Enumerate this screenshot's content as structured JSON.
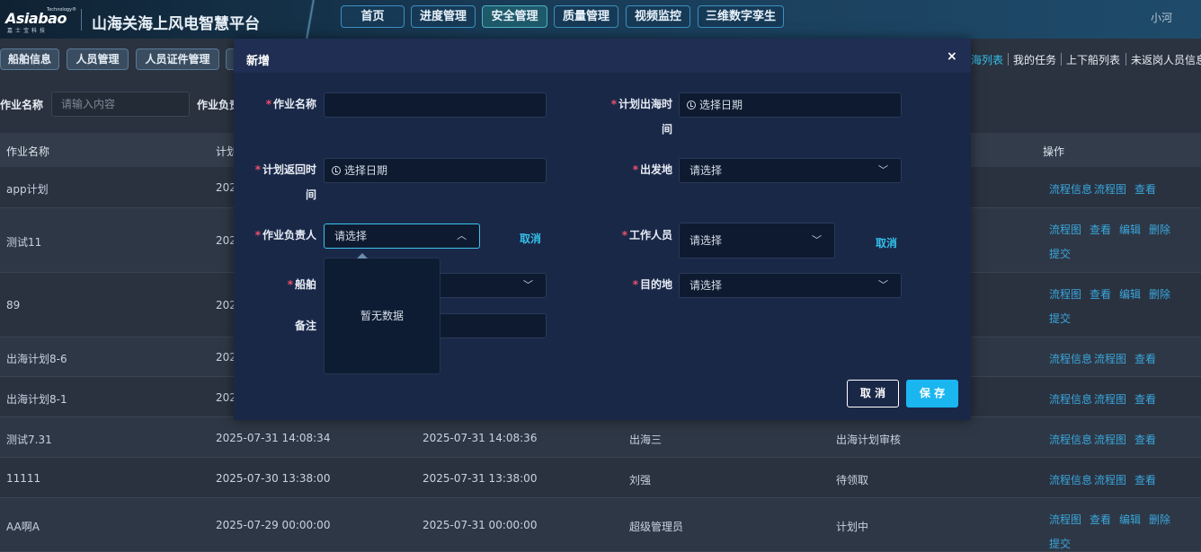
{
  "header": {
    "logo_text": "Asiabao",
    "logo_small": "Technology®",
    "logo_cn": "嘉士宝科技",
    "app_title": "山海关海上风电智慧平台",
    "nav": [
      "首页",
      "进度管理",
      "安全管理",
      "质量管理",
      "视频监控",
      "三维数字孪生"
    ],
    "active_nav": "安全管理",
    "user": "小河"
  },
  "subnav": {
    "buttons": [
      "船舶信息",
      "人员管理",
      "人员证件管理"
    ],
    "links": [
      "海列表",
      "我的任务",
      "上下船列表",
      "未返岗人员信息"
    ]
  },
  "filters": {
    "label1": "作业名称",
    "placeholder1": "请输入内容",
    "label2": "作业负责"
  },
  "table": {
    "headers": [
      "作业名称",
      "计划",
      "操作"
    ],
    "rows": [
      {
        "name": "app计划",
        "c2": "202",
        "c3": "",
        "c4": "",
        "c5": "",
        "ops": [
          "流程信息",
          "流程图",
          "查看"
        ]
      },
      {
        "name": "测试11",
        "c2": "202",
        "c3": "",
        "c4": "",
        "c5": "",
        "ops": [
          "流程图",
          "查看",
          "编辑",
          "删除",
          "提交"
        ]
      },
      {
        "name": "89",
        "c2": "202",
        "c3": "",
        "c4": "",
        "c5": "",
        "ops": [
          "流程图",
          "查看",
          "编辑",
          "删除",
          "提交"
        ]
      },
      {
        "name": "出海计划8-6",
        "c2": "202",
        "c3": "",
        "c4": "",
        "c5": "",
        "ops": [
          "流程信息",
          "流程图",
          "查看"
        ]
      },
      {
        "name": "出海计划8-1",
        "c2": "202",
        "c3": "",
        "c4": "",
        "c5": "",
        "ops": [
          "流程信息",
          "流程图",
          "查看"
        ]
      },
      {
        "name": "测试7.31",
        "c2": "2025-07-31 14:08:34",
        "c3": "2025-07-31 14:08:36",
        "c4": "出海三",
        "c5": "出海计划审核",
        "ops": [
          "流程信息",
          "流程图",
          "查看"
        ]
      },
      {
        "name": "11111",
        "c2": "2025-07-30 13:38:00",
        "c3": "2025-07-31 13:38:00",
        "c4": "刘强",
        "c5": "待领取",
        "ops": [
          "流程信息",
          "流程图",
          "查看"
        ]
      },
      {
        "name": "AA啊A",
        "c2": "2025-07-29 00:00:00",
        "c3": "2025-07-31 00:00:00",
        "c4": "超级管理员",
        "c5": "计划中",
        "ops": [
          "流程图",
          "查看",
          "编辑",
          "删除",
          "提交"
        ]
      }
    ]
  },
  "modal": {
    "title": "新增",
    "close": "×",
    "fields": {
      "job_name": {
        "label": "作业名称",
        "value": ""
      },
      "plan_out": {
        "label1": "计划出海时",
        "label2": "间",
        "placeholder": "选择日期"
      },
      "plan_back": {
        "label1": "计划返回时",
        "label2": "间",
        "placeholder": "选择日期"
      },
      "depart": {
        "label": "出发地",
        "placeholder": "请选择"
      },
      "leader": {
        "label": "作业负责人",
        "placeholder": "请选择",
        "cancel": "取消"
      },
      "workers": {
        "label": "工作人员",
        "placeholder": "请选择",
        "cancel": "取消"
      },
      "ship": {
        "label": "船舶"
      },
      "dest": {
        "label": "目的地",
        "placeholder": "请选择"
      },
      "remark": {
        "label": "备注"
      }
    },
    "dropdown_empty": "暂无数据",
    "btn_cancel": "取 消",
    "btn_save": "保 存"
  },
  "colors": {
    "accent": "#1ab6f0",
    "required": "#f0506e",
    "link": "#3aa6dc",
    "modal_bg": "#1a2848"
  }
}
